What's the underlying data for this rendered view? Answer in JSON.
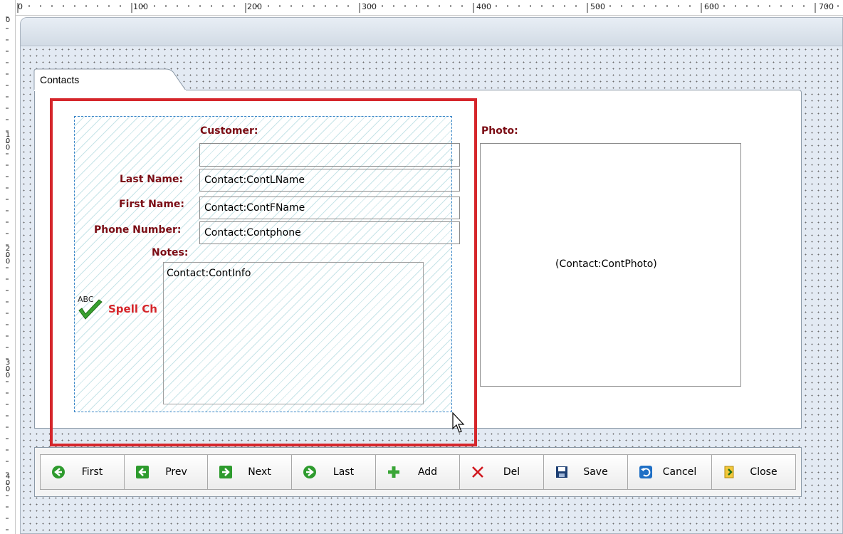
{
  "ruler": {
    "top_labels": [
      "0",
      "100",
      "200",
      "300",
      "400",
      "500",
      "600",
      "700"
    ],
    "left_labels": [
      "0",
      "100",
      "200",
      "300",
      "400"
    ]
  },
  "tab": {
    "label": "Contacts"
  },
  "form": {
    "customer_label": "Customer:",
    "customer_value": "",
    "last_name_label": "Last Name:",
    "last_name_value": "Contact:ContLName",
    "first_name_label": "First Name:",
    "first_name_value": "Contact:ContFName",
    "phone_label": "Phone Number:",
    "phone_value": "Contact:Contphone",
    "notes_label": "Notes:",
    "notes_value": "Contact:ContInfo",
    "spell_label": "Spell Ch",
    "photo_label": "Photo:",
    "photo_value": "(Contact:ContPhoto)"
  },
  "toolbar": {
    "buttons": [
      {
        "label": "First",
        "icon": "arrow-left-circle-icon"
      },
      {
        "label": "Prev",
        "icon": "arrow-left-square-icon"
      },
      {
        "label": "Next",
        "icon": "arrow-right-square-icon"
      },
      {
        "label": "Last",
        "icon": "arrow-right-circle-icon"
      },
      {
        "label": "Add",
        "icon": "plus-icon"
      },
      {
        "label": "Del",
        "icon": "delete-x-icon"
      },
      {
        "label": "Save",
        "icon": "floppy-disk-icon"
      },
      {
        "label": "Cancel",
        "icon": "undo-icon"
      },
      {
        "label": "Close",
        "icon": "exit-icon"
      }
    ]
  },
  "colors": {
    "label_red": "#7b0c14",
    "selection_red": "#d5262b",
    "group_border_blue": "#3a86c8"
  }
}
